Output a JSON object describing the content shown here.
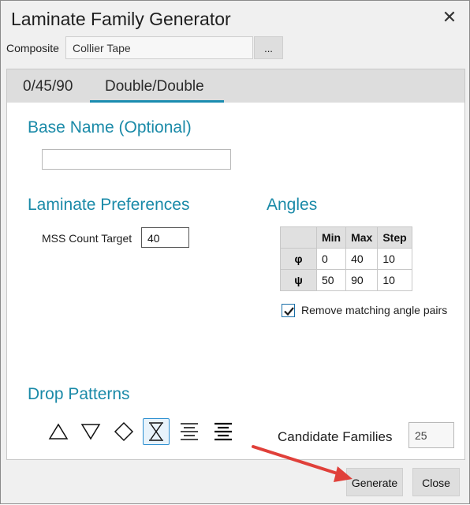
{
  "window": {
    "title": "Laminate Family Generator",
    "close_glyph": "✕"
  },
  "composite": {
    "label": "Composite",
    "value": "Collier Tape",
    "browse_label": "..."
  },
  "tabs": [
    {
      "label": "0/45/90",
      "active": false
    },
    {
      "label": "Double/Double",
      "active": true
    }
  ],
  "base_name": {
    "heading": "Base Name (Optional)",
    "value": ""
  },
  "laminate_prefs": {
    "heading": "Laminate Preferences",
    "mss_label": "MSS Count Target",
    "mss_value": "40"
  },
  "angles": {
    "heading": "Angles",
    "columns": [
      "",
      "Min",
      "Max",
      "Step"
    ],
    "rows": [
      {
        "label": "φ",
        "min": "0",
        "max": "40",
        "step": "10"
      },
      {
        "label": "ψ",
        "min": "50",
        "max": "90",
        "step": "10"
      }
    ],
    "remove_pairs_label": "Remove matching angle pairs",
    "remove_pairs_checked": true
  },
  "drop_patterns": {
    "heading": "Drop Patterns",
    "icons": [
      "triangle-up-icon",
      "triangle-down-icon",
      "diamond-icon",
      "hourglass-icon",
      "align-center-lines-icon",
      "align-center-lines-bold-icon"
    ],
    "selected": "hourglass-icon"
  },
  "candidate_families": {
    "label": "Candidate Families",
    "value": "25"
  },
  "buttons": {
    "generate": "Generate",
    "close": "Close"
  },
  "colors": {
    "accent": "#1a8aa8",
    "arrow": "#e0403a",
    "tab_underline": "#1a8cb0"
  }
}
